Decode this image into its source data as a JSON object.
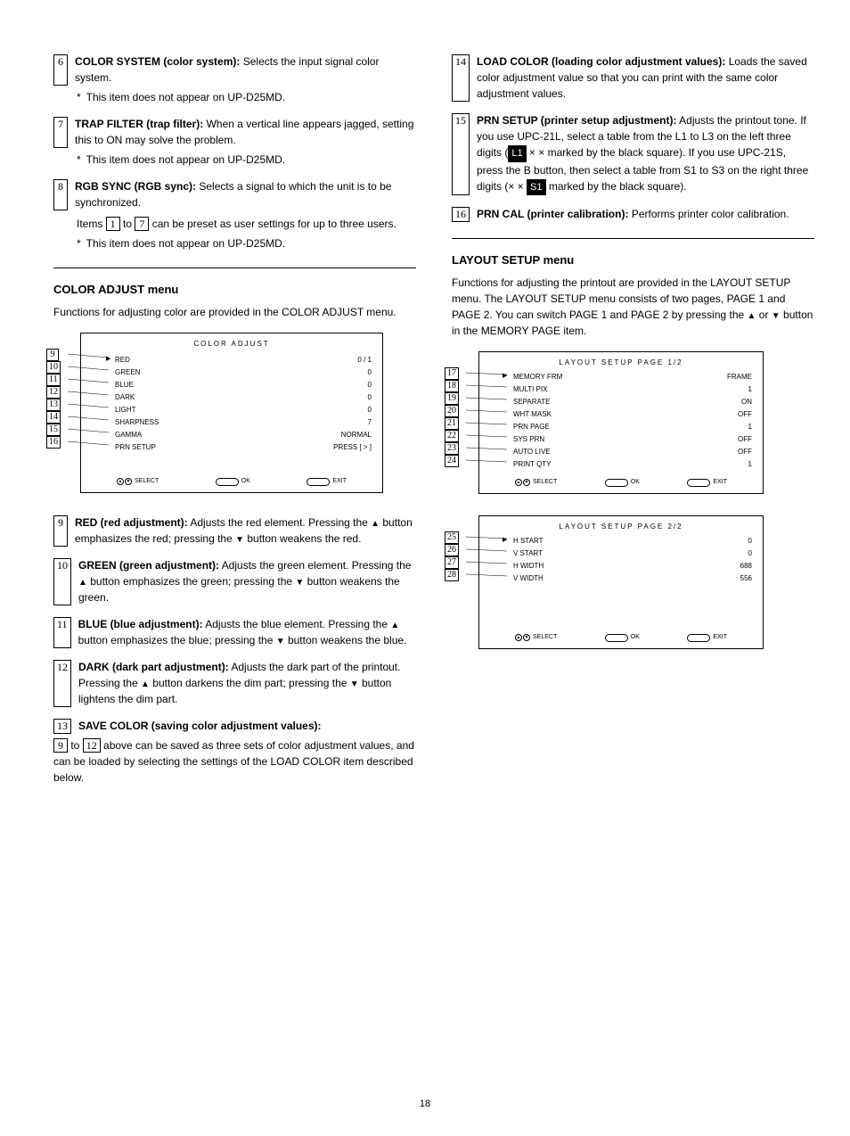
{
  "left_items": {
    "i6": {
      "label": "6",
      "title": "COLOR SYSTEM (color system):",
      "body": "Selects the input signal color system.",
      "note": "This item does not appear on UP-D25MD."
    },
    "i7": {
      "label": "7",
      "title": "TRAP FILTER (trap filter):",
      "body": "When a vertical line appears jagged, setting this to ON may solve the problem.",
      "note": "This item does not appear on UP-D25MD."
    },
    "i8": {
      "label": "8",
      "title": "RGB SYNC (RGB sync):",
      "body": "Selects a signal to which the unit is to be synchronized."
    }
  },
  "after8": {
    "pretext": "Items ",
    "ref1": "1",
    "midtext": " to ",
    "ref2": "7",
    "posttext": " can be preset as user settings for up to three users.",
    "note": "This item does not appear on UP-D25MD."
  },
  "section_color": {
    "title": "COLOR ADJUST menu",
    "desc": "Functions for adjusting color are provided in the COLOR ADJUST menu."
  },
  "menu1": {
    "title": "COLOR  ADJUST",
    "rows": [
      {
        "l": "RED",
        "r": "0  /  1"
      },
      {
        "l": "GREEN",
        "r": "0"
      },
      {
        "l": "BLUE",
        "r": "0"
      },
      {
        "l": "DARK",
        "r": "0"
      },
      {
        "l": "LIGHT",
        "r": "0"
      },
      {
        "l": "SHARPNESS",
        "r": "7"
      },
      {
        "l": "GAMMA",
        "r": "NORMAL"
      },
      {
        "l": "PRN SETUP",
        "r": "PRESS  [ > ]"
      }
    ],
    "bottom": {
      "sel": "SELECT",
      "ok": "OK",
      "exit": "EXIT"
    },
    "labels": [
      "9",
      "10",
      "11",
      "12",
      "13",
      "14",
      "15",
      "16"
    ]
  },
  "color_items": {
    "i9": {
      "label": "9",
      "title": "RED (red adjustment):",
      "body": "Adjusts the red element. Pressing the V button emphasizes the red; pressing the v button weakens the red."
    },
    "i10": {
      "label": "10",
      "title": "GREEN (green adjustment):",
      "body": "Adjusts the green element. Pressing the V button emphasizes the green; pressing the v button weakens the green."
    },
    "i11": {
      "label": "11",
      "title": "BLUE (blue adjustment):",
      "body": "Adjusts the blue element. Pressing the V button emphasizes the blue; pressing the v button weakens the blue."
    },
    "i12": {
      "label": "12",
      "title": "DARK (dark part adjustment):",
      "body": "Adjusts the dark part of the printout. Pressing the V button darkens the dim part; pressing the v button lightens the dim part."
    },
    "i13": {
      "label": "13",
      "title": "SAVE COLOR (saving color adjustment values):",
      "body": ""
    }
  },
  "after13": {
    "ref1": "9",
    "mid": " to ",
    "ref2": "12",
    "post": " above can be saved as three sets of color adjustment values, and can be loaded by selecting the settings of the LOAD COLOR item described below."
  },
  "right_items": {
    "i14": {
      "label": "14",
      "title": "LOAD COLOR (loading color adjustment values):",
      "body": "Loads the saved color adjustment value so that you can print with the same color adjustment values."
    },
    "i15": {
      "label": "15",
      "title": "PRN SETUP (printer setup adjustment):",
      "body_parts": [
        "Adjusts the printout tone. If you use UPC-21L, select a table from the L1 to L3 on the left three digits (",
        " × × marked by the black square). If you use UPC-21S, press the ",
        " button, then select a table from S1 to S3 on the right three digits (× × ",
        " marked by the black square)."
      ],
      "ex1": "L1",
      "btn": "B",
      "ex2": "S1"
    },
    "i16": {
      "label": "16",
      "title": "PRN CAL (printer calibration):",
      "body": "Performs printer color calibration."
    }
  },
  "section_layout": {
    "title": "LAYOUT SETUP menu",
    "desc_pre": "Functions for adjusting the printout are provided in the LAYOUT SETUP menu. The LAYOUT SETUP menu consists of two pages, PAGE 1 and PAGE 2. You can switch PAGE 1 and PAGE 2 by pressing the ",
    "desc_mid": " or ",
    "desc_post": " button in the MEMORY PAGE item."
  },
  "menu2": {
    "title": "LAYOUT  SETUP    PAGE 1/2",
    "rows": [
      {
        "l": "MEMORY FRM",
        "r": "FRAME"
      },
      {
        "l": "MULTI PIX",
        "r": "1"
      },
      {
        "l": "SEPARATE",
        "r": "ON"
      },
      {
        "l": "WHT MASK",
        "r": "OFF"
      },
      {
        "l": "PRN PAGE",
        "r": "1"
      },
      {
        "l": "SYS PRN",
        "r": "OFF"
      },
      {
        "l": "AUTO LIVE",
        "r": "OFF"
      },
      {
        "l": "PRINT QTY",
        "r": "1"
      }
    ],
    "bottom": {
      "sel": "SELECT",
      "ok": "OK",
      "exit": "EXIT"
    },
    "labels": [
      "17",
      "18",
      "19",
      "20",
      "21",
      "22",
      "23",
      "24"
    ]
  },
  "menu3": {
    "title": "LAYOUT  SETUP    PAGE 2/2",
    "rows": [
      {
        "l": "H START",
        "r": "0"
      },
      {
        "l": "V START",
        "r": "0"
      },
      {
        "l": "H WIDTH",
        "r": "688"
      },
      {
        "l": "V WIDTH",
        "r": "556"
      }
    ],
    "bottom": {
      "sel": "SELECT",
      "ok": "OK",
      "exit": "EXIT"
    },
    "labels": [
      "25",
      "26",
      "27",
      "28"
    ]
  },
  "page": "18"
}
